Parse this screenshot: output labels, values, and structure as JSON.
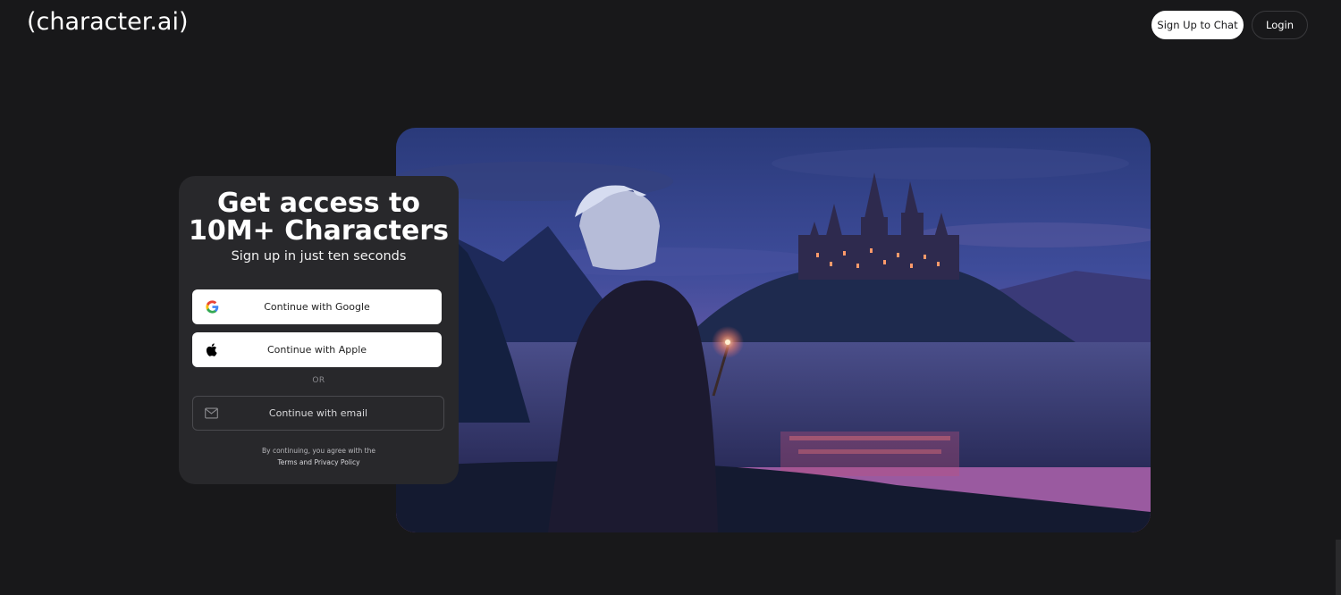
{
  "header": {
    "logo": "(character.ai)",
    "signup_label": "Sign Up to Chat",
    "login_label": "Login"
  },
  "card": {
    "title": "Get access to\n10M+ Characters",
    "subtitle": "Sign up in just ten seconds",
    "google_label": "Continue with Google",
    "apple_label": "Continue with Apple",
    "or_label": "OR",
    "email_label": "Continue with email",
    "legal_line1": "By continuing, you agree with the",
    "terms_label": "Terms",
    "and_label": "and",
    "privacy_label": "Privacy Policy"
  },
  "icons": {
    "google": "google-icon",
    "apple": "apple-icon",
    "email": "mail-icon"
  },
  "colors": {
    "background": "#18181a",
    "card": "#28282b",
    "button": "#ffffff"
  }
}
